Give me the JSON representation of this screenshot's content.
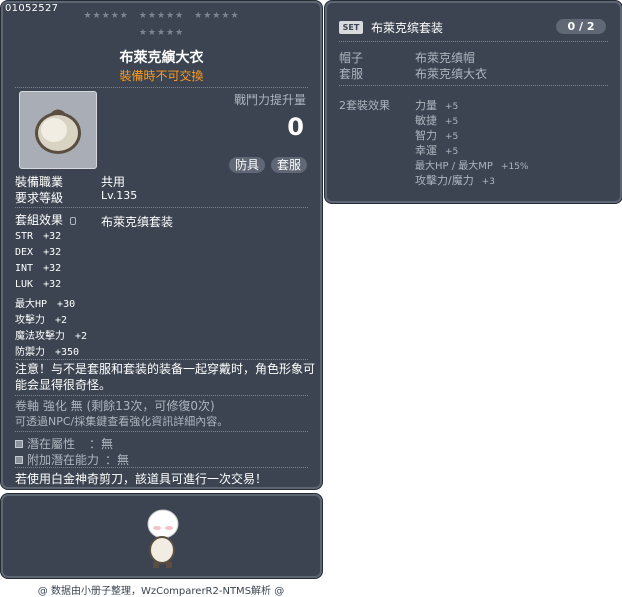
{
  "item": {
    "code": "01052527",
    "title": "布萊克縯大衣",
    "subtitle": "裝備時不可交換",
    "boost_label": "戰鬥力提升量",
    "boost_value": "0",
    "tags": [
      "防具",
      "套服"
    ],
    "req_job_label": "裝備職業",
    "req_job_value": "共用",
    "req_level_label": "要求等級",
    "req_level_value": "Lv.135",
    "set_effect_label": "套組效果",
    "set_effect_value": "布萊克缜套装",
    "stats": [
      {
        "name": "STR",
        "value": "+32"
      },
      {
        "name": "DEX",
        "value": "+32"
      },
      {
        "name": "INT",
        "value": "+32"
      },
      {
        "name": "LUK",
        "value": "+32"
      },
      {
        "name": "最大HP",
        "value": "+30"
      },
      {
        "name": "攻擊力",
        "value": "+2"
      },
      {
        "name": "魔法攻擊力",
        "value": "+2"
      },
      {
        "name": "防禦力",
        "value": "+350"
      }
    ],
    "notice": "注意！与不是套服和套装的装备一起穿戴时，角色形象可能会显得很奇怪。",
    "scroll_line": "卷軸 強化 無 (剩餘13次，可修復0次)",
    "npc_line": "可透過NPC/採集鍵查看強化資訊詳細內容。",
    "potential_label": "潛在屬性",
    "potential_value": "：無",
    "additional_label": "附加潛在能力",
    "additional_value": "：無",
    "trade_line": "若使用白金神奇剪刀，該道具可進行一次交易！"
  },
  "set": {
    "badge": "SET",
    "title": "布萊克缤套装",
    "count": "0 / 2",
    "parts": [
      {
        "slot": "帽子",
        "name": "布萊克缜帽"
      },
      {
        "slot": "套服",
        "name": "布萊克缜大衣"
      }
    ],
    "bonus_label": "2套裝效果",
    "bonus": [
      {
        "name": "力量",
        "value": "+5"
      },
      {
        "name": "敏捷",
        "value": "+5"
      },
      {
        "name": "智力",
        "value": "+5"
      },
      {
        "name": "幸運",
        "value": "+5"
      },
      {
        "name": "最大HP / 最大MP",
        "value": "+15%"
      },
      {
        "name": "攻擊力/魔力",
        "value": "+3"
      }
    ]
  },
  "footer": "@ 数据由小册子整理，WzComparerR2-NTMS解析 @"
}
